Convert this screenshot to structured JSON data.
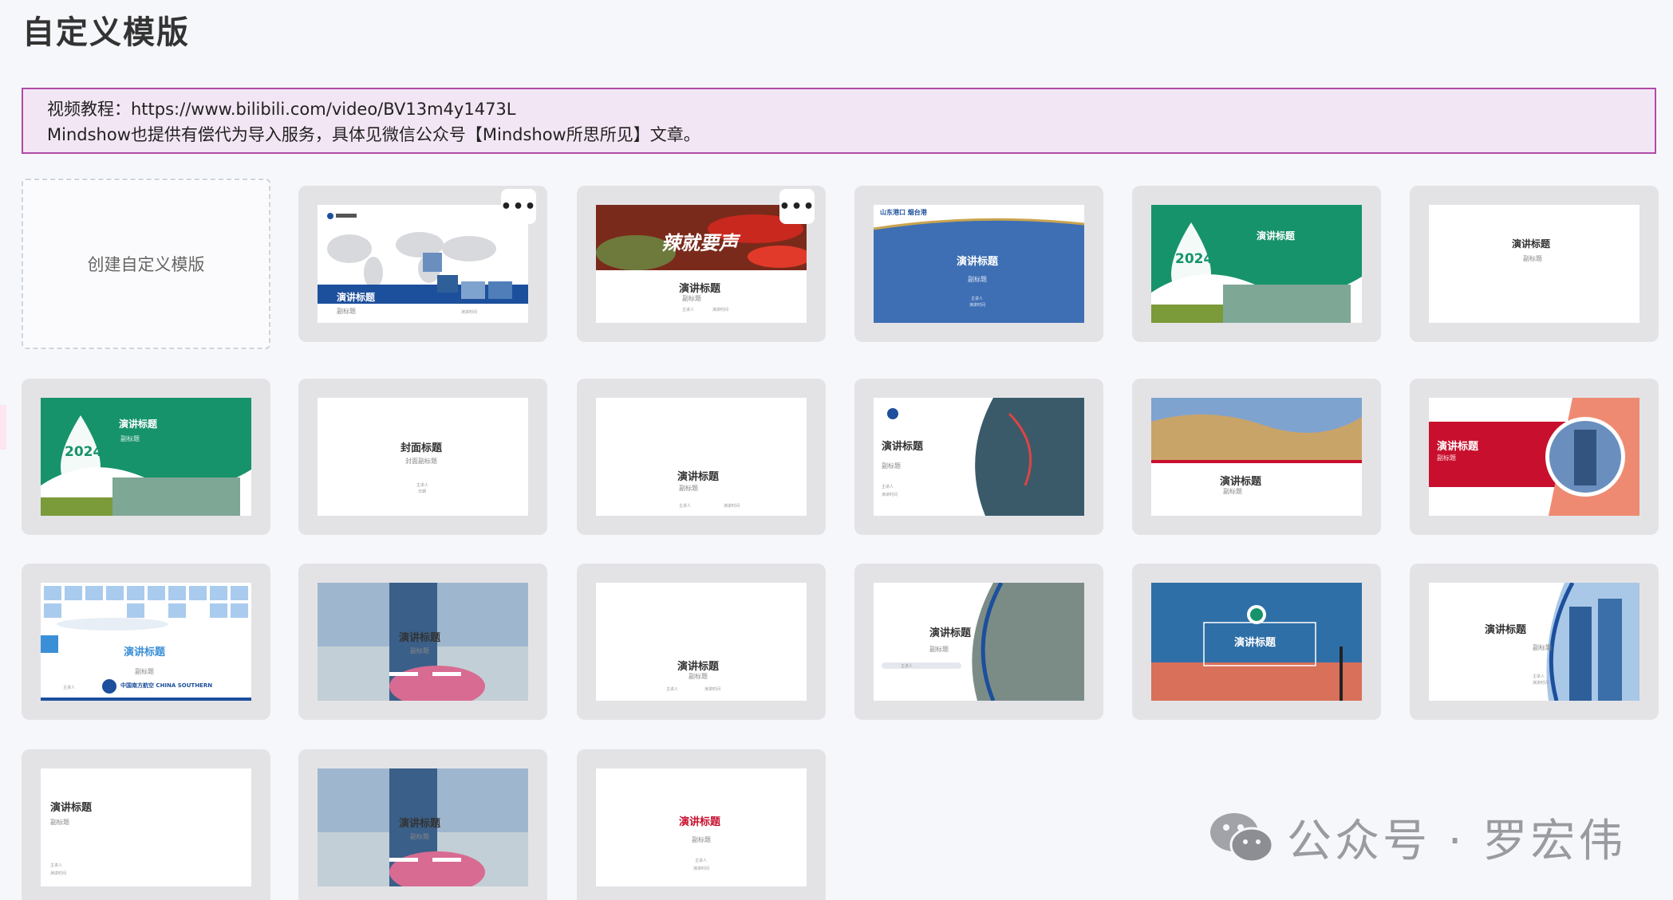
{
  "page": {
    "title": "自定义模版"
  },
  "notice": {
    "line1": "视频教程：https://www.bilibili.com/video/BV13m4y1473L",
    "line2": "Mindshow也提供有偿代为导入服务，具体见微信公众号【Mindshow所思所见】文章。"
  },
  "create_card": {
    "label": "创建自定义模版"
  },
  "more_label": "•••",
  "watermark": {
    "text": "公众号 · 罗宏伟",
    "icon": "wechat-icon"
  },
  "templates": [
    {
      "title": "演讲标题",
      "subtitle": "副标题",
      "meta1": "主讲人",
      "meta2": "演讲时间"
    },
    {
      "title": "辣就要声",
      "heading": "演讲标题",
      "subtitle": "副标题",
      "meta1": "主讲人",
      "meta2": "演讲时间"
    },
    {
      "brand": "山东港口 烟台港",
      "title": "演讲标题",
      "subtitle": "副标题",
      "meta1": "主讲人",
      "meta2": "演讲时间"
    },
    {
      "title": "演讲标题",
      "year": "2024"
    },
    {
      "title": "演讲标题",
      "subtitle": "副标题"
    },
    {
      "title": "演讲标题",
      "subtitle": "副标题",
      "year": "2024"
    },
    {
      "title": "封面标题",
      "subtitle": "封面副标题",
      "meta1": "主讲人",
      "meta2": "日期"
    },
    {
      "title": "演讲标题",
      "subtitle": "副标题",
      "meta1": "主讲人",
      "meta2": "演讲时间"
    },
    {
      "title": "演讲标题",
      "subtitle": "副标题",
      "meta1": "主讲人",
      "meta2": "演讲时间"
    },
    {
      "title": "演讲标题",
      "subtitle": "副标题"
    },
    {
      "title": "演讲标题",
      "subtitle": "副标题"
    },
    {
      "title": "演讲标题",
      "subtitle": "副标题",
      "brand": "中国南方航空 CHINA SOUTHERN",
      "meta1": "主讲人"
    },
    {
      "title": "演讲标题",
      "subtitle": "副标题"
    },
    {
      "title": "演讲标题",
      "subtitle": "副标题",
      "meta1": "主讲人",
      "meta2": "演讲时间"
    },
    {
      "title": "演讲标题",
      "subtitle": "副标题",
      "meta1": "主讲人"
    },
    {
      "title": "演讲标题"
    },
    {
      "title": "演讲标题",
      "subtitle": "副标题",
      "meta1": "主讲人",
      "meta2": "演讲时间"
    },
    {
      "title": "演讲标题",
      "subtitle": "副标题",
      "meta1": "主讲人",
      "meta2": "演讲时间"
    },
    {
      "title": "演讲标题",
      "subtitle": "副标题"
    },
    {
      "title": "演讲标题",
      "subtitle": "副标题",
      "meta1": "主讲人",
      "meta2": "演讲时间"
    }
  ],
  "colors": {
    "accent_border": "#b04aa8",
    "notice_bg": "#f3e6f4",
    "card_bg": "#e3e3e6",
    "green": "#17936b",
    "blue": "#1c4f9c",
    "red": "#c8102e"
  }
}
